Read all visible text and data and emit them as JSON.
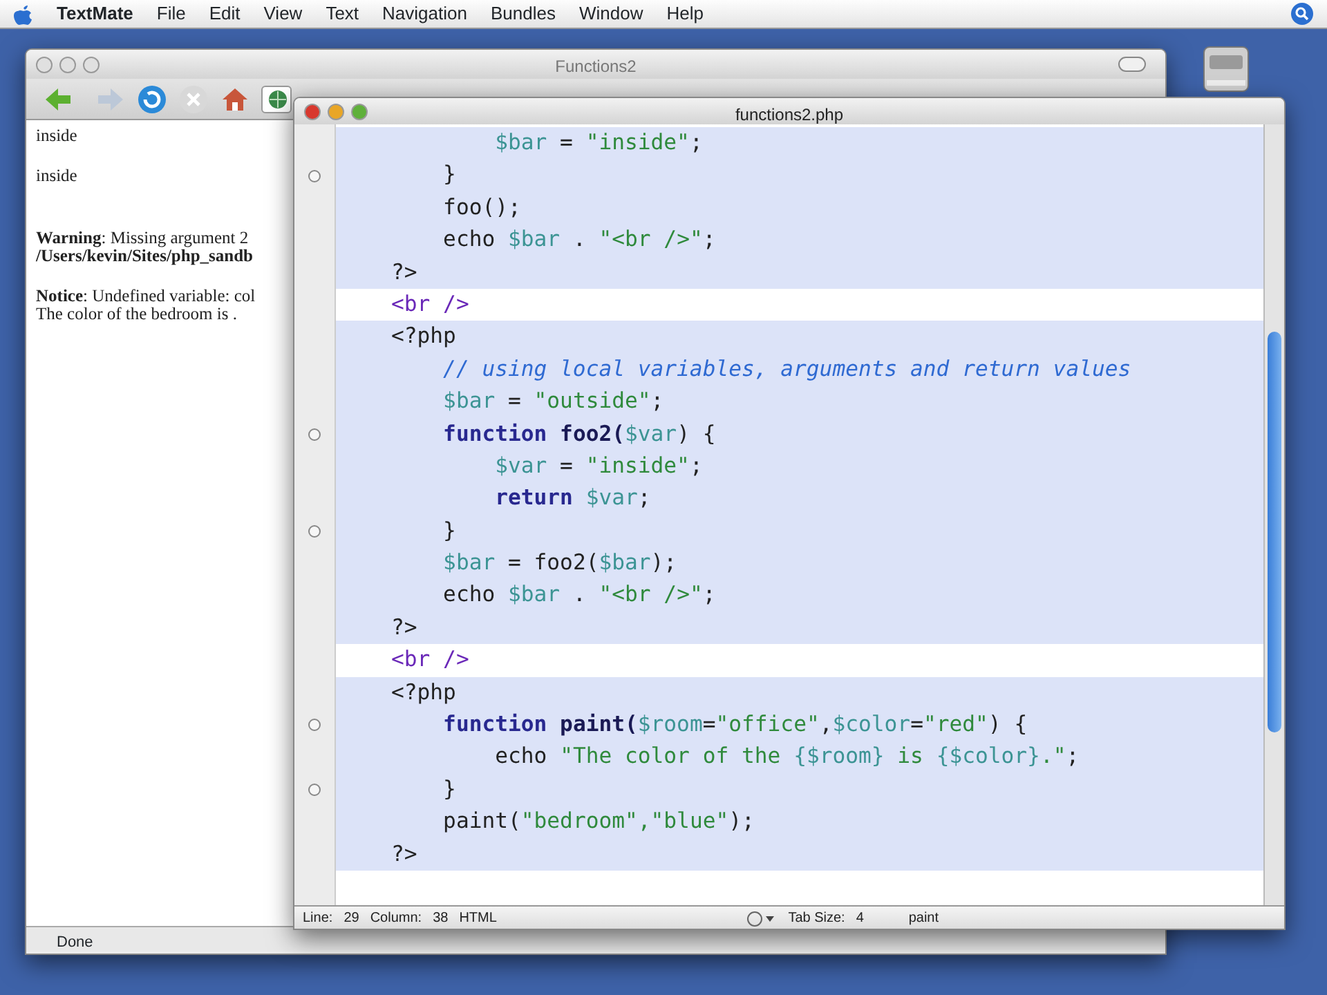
{
  "menu_bar": {
    "app": "TextMate",
    "items": [
      "File",
      "Edit",
      "View",
      "Text",
      "Navigation",
      "Bundles",
      "Window",
      "Help"
    ]
  },
  "browser": {
    "title": "Functions2",
    "content": [
      {
        "kind": "text",
        "text": "inside"
      },
      {
        "kind": "text",
        "text": "inside"
      },
      {
        "kind": "message",
        "text": "**Warning**: Missing argument 2"
      },
      {
        "kind": "path",
        "text": "/Users/kevin/Sites/php_sandb"
      },
      {
        "kind": "message",
        "text": "**Notice**: Undefined variable: col"
      },
      {
        "kind": "text",
        "text": "The color of the bedroom is ."
      }
    ],
    "status_bar": "Done"
  },
  "editor": {
    "title": "functions2.php",
    "lines": [
      {
        "kind": "php",
        "fold_mark": false,
        "tokens": [
          {
            "t": "        $bar",
            "kind": "var"
          },
          {
            "t": " = ",
            "kind": "plain"
          },
          {
            "t": "\"inside\"",
            "kind": "string"
          },
          {
            "t": ";",
            "kind": "plain"
          }
        ]
      },
      {
        "kind": "php",
        "fold_mark": true,
        "tokens": [
          {
            "t": "    }",
            "kind": "plain"
          }
        ]
      },
      {
        "kind": "php",
        "fold_mark": false,
        "tokens": [
          {
            "t": "    foo();",
            "kind": "plain"
          }
        ]
      },
      {
        "kind": "php",
        "fold_mark": false,
        "tokens": [
          {
            "t": "    echo ",
            "kind": "plain"
          },
          {
            "t": "$bar",
            "kind": "var"
          },
          {
            "t": " . ",
            "kind": "plain"
          },
          {
            "t": "\"<br />\"",
            "kind": "string"
          },
          {
            "t": ";",
            "kind": "plain"
          }
        ]
      },
      {
        "kind": "php",
        "fold_mark": false,
        "tokens": [
          {
            "t": "?>",
            "kind": "plain"
          }
        ]
      },
      {
        "kind": "html",
        "fold_mark": false,
        "tokens": [
          {
            "t": "<br />",
            "kind": "tag"
          }
        ]
      },
      {
        "kind": "php",
        "fold_mark": false,
        "tokens": [
          {
            "t": "<?php",
            "kind": "plain"
          }
        ]
      },
      {
        "kind": "php",
        "fold_mark": false,
        "tokens": [
          {
            "t": "    // using local variables, arguments and return values",
            "kind": "comment"
          }
        ]
      },
      {
        "kind": "php",
        "fold_mark": false,
        "tokens": [
          {
            "t": "    $bar",
            "kind": "var"
          },
          {
            "t": " = ",
            "kind": "plain"
          },
          {
            "t": "\"outside\"",
            "kind": "string"
          },
          {
            "t": ";",
            "kind": "plain"
          }
        ]
      },
      {
        "kind": "php",
        "fold_mark": true,
        "tokens": [
          {
            "t": "    function",
            "kind": "keyword"
          },
          {
            "t": " foo2(",
            "kind": "func"
          },
          {
            "t": "$var",
            "kind": "var"
          },
          {
            "t": ") {",
            "kind": "plain"
          }
        ]
      },
      {
        "kind": "php",
        "fold_mark": false,
        "tokens": [
          {
            "t": "        $var",
            "kind": "var"
          },
          {
            "t": " = ",
            "kind": "plain"
          },
          {
            "t": "\"inside\"",
            "kind": "string"
          },
          {
            "t": ";",
            "kind": "plain"
          }
        ]
      },
      {
        "kind": "php",
        "fold_mark": false,
        "tokens": [
          {
            "t": "        return",
            "kind": "keyword"
          },
          {
            "t": " $var",
            "kind": "var"
          },
          {
            "t": ";",
            "kind": "plain"
          }
        ]
      },
      {
        "kind": "php",
        "fold_mark": true,
        "tokens": [
          {
            "t": "    }",
            "kind": "plain"
          }
        ]
      },
      {
        "kind": "php",
        "fold_mark": false,
        "tokens": [
          {
            "t": "    $bar",
            "kind": "var"
          },
          {
            "t": " = foo2(",
            "kind": "plain"
          },
          {
            "t": "$bar",
            "kind": "var"
          },
          {
            "t": ");",
            "kind": "plain"
          }
        ]
      },
      {
        "kind": "php",
        "fold_mark": false,
        "tokens": [
          {
            "t": "    echo ",
            "kind": "plain"
          },
          {
            "t": "$bar",
            "kind": "var"
          },
          {
            "t": " . ",
            "kind": "plain"
          },
          {
            "t": "\"<br />\"",
            "kind": "string"
          },
          {
            "t": ";",
            "kind": "plain"
          }
        ]
      },
      {
        "kind": "php",
        "fold_mark": false,
        "tokens": [
          {
            "t": "?>",
            "kind": "plain"
          }
        ]
      },
      {
        "kind": "html",
        "fold_mark": false,
        "tokens": [
          {
            "t": "<br />",
            "kind": "tag"
          }
        ]
      },
      {
        "kind": "php",
        "fold_mark": false,
        "tokens": [
          {
            "t": "<?php",
            "kind": "plain"
          }
        ]
      },
      {
        "kind": "php",
        "fold_mark": true,
        "tokens": [
          {
            "t": "    function",
            "kind": "keyword"
          },
          {
            "t": " paint(",
            "kind": "func"
          },
          {
            "t": "$room",
            "kind": "var"
          },
          {
            "t": "=",
            "kind": "plain"
          },
          {
            "t": "\"office\"",
            "kind": "string"
          },
          {
            "t": ",",
            "kind": "plain"
          },
          {
            "t": "$color",
            "kind": "var"
          },
          {
            "t": "=",
            "kind": "plain"
          },
          {
            "t": "\"red\"",
            "kind": "string"
          },
          {
            "t": ") {",
            "kind": "plain"
          }
        ]
      },
      {
        "kind": "php",
        "fold_mark": false,
        "tokens": [
          {
            "t": "        echo ",
            "kind": "plain"
          },
          {
            "t": "\"The color of the ",
            "kind": "string"
          },
          {
            "t": "{$room}",
            "kind": "var"
          },
          {
            "t": " is ",
            "kind": "string"
          },
          {
            "t": "{$color}",
            "kind": "var"
          },
          {
            "t": ".\"",
            "kind": "string"
          },
          {
            "t": ";",
            "kind": "plain"
          }
        ]
      },
      {
        "kind": "php",
        "fold_mark": true,
        "tokens": [
          {
            "t": "    }",
            "kind": "plain"
          }
        ]
      },
      {
        "kind": "php",
        "fold_mark": false,
        "tokens": [
          {
            "t": "    paint(",
            "kind": "plain"
          },
          {
            "t": "\"bedroom\"",
            "kind": "string"
          },
          {
            "t": ",\"blue\"",
            "kind": "string"
          },
          {
            "t": ");",
            "kind": "plain"
          }
        ]
      },
      {
        "kind": "php",
        "fold_mark": false,
        "tokens": [
          {
            "t": "?>",
            "kind": "plain"
          }
        ]
      }
    ],
    "status_bar": {
      "line_label": "Line:",
      "line": "29",
      "column_label": "Column:",
      "column": "38",
      "language": "HTML",
      "tab_size_label": "Tab Size:",
      "tab_size": "4",
      "symbol": "paint"
    }
  }
}
